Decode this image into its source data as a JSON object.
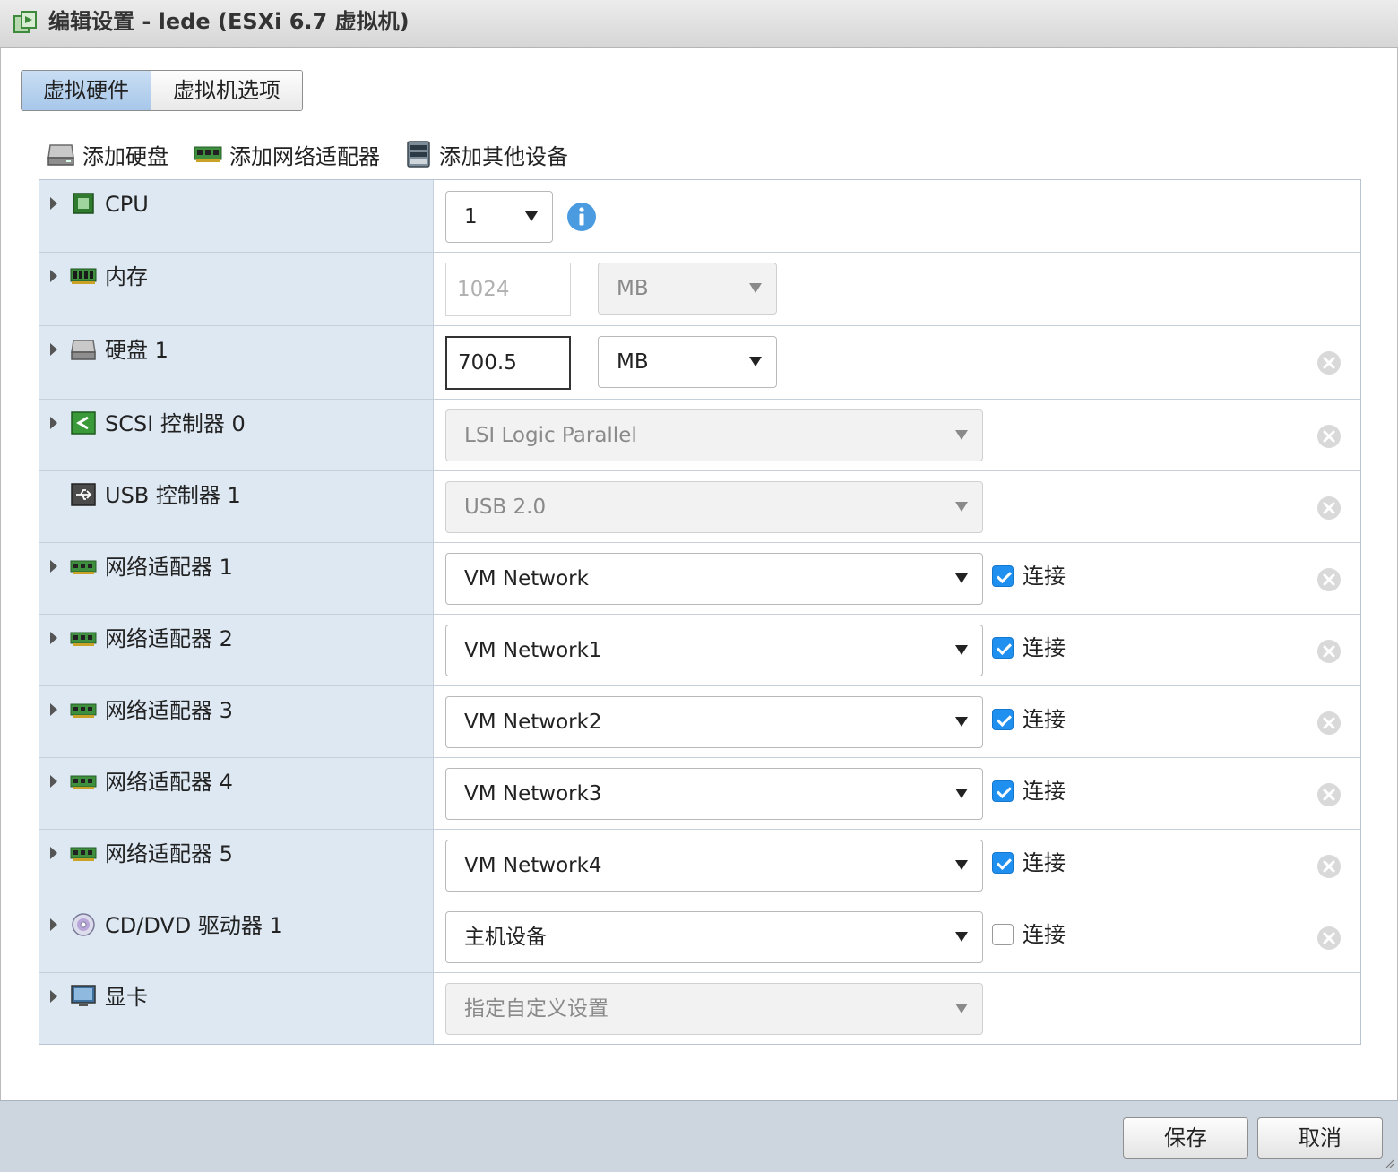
{
  "window": {
    "title": "编辑设置 - lede (ESXi 6.7 虚拟机)"
  },
  "tabs": [
    {
      "label": "虚拟硬件",
      "active": true
    },
    {
      "label": "虚拟机选项",
      "active": false
    }
  ],
  "toolbar": {
    "add_disk": "添加硬盘",
    "add_network_adapter": "添加网络适配器",
    "add_other_device": "添加其他设备"
  },
  "hardware": {
    "cpu": {
      "label": "CPU",
      "value": "1"
    },
    "memory": {
      "label": "内存",
      "value": "1024",
      "unit": "MB"
    },
    "disk": {
      "label": "硬盘 1",
      "value": "700.5",
      "unit": "MB"
    },
    "scsi": {
      "label": "SCSI 控制器 0",
      "value": "LSI Logic Parallel"
    },
    "usb": {
      "label": "USB 控制器 1",
      "value": "USB 2.0"
    },
    "network_adapters": [
      {
        "label": "网络适配器 1",
        "network": "VM Network",
        "connect_label": "连接",
        "connected": true
      },
      {
        "label": "网络适配器 2",
        "network": "VM Network1",
        "connect_label": "连接",
        "connected": true
      },
      {
        "label": "网络适配器 3",
        "network": "VM Network2",
        "connect_label": "连接",
        "connected": true
      },
      {
        "label": "网络适配器 4",
        "network": "VM Network3",
        "connect_label": "连接",
        "connected": true
      },
      {
        "label": "网络适配器 5",
        "network": "VM Network4",
        "connect_label": "连接",
        "connected": true
      }
    ],
    "cdrom": {
      "label": "CD/DVD 驱动器 1",
      "value": "主机设备",
      "connect_label": "连接",
      "connected": false
    },
    "video": {
      "label": "显卡",
      "value": "指定自定义设置"
    }
  },
  "footer": {
    "save_label": "保存",
    "cancel_label": "取消"
  },
  "colors": {
    "accent": "#1f8ff0",
    "label_column_bg": "#dde8f3",
    "footer_bg": "#cdd6df",
    "active_tab": "#b5d1ee"
  }
}
